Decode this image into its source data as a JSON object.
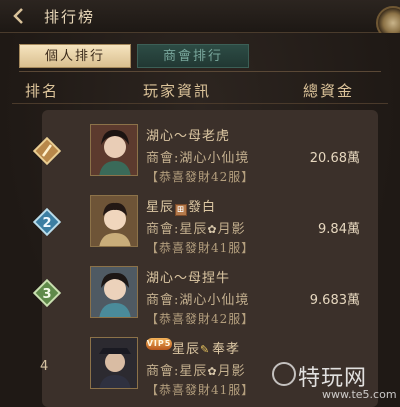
{
  "header": {
    "title": "排行榜"
  },
  "tabs": [
    {
      "label": "個人排行",
      "active": true
    },
    {
      "label": "商會排行",
      "active": false
    }
  ],
  "columns": {
    "rank": "排名",
    "player": "玩家資訊",
    "funds": "總資金"
  },
  "unit": "萬",
  "rows": [
    {
      "rank": "1",
      "rank_icon": "rank-1-diamond-icon",
      "name_prefix": "湖心～母老虎",
      "name_suffix": "",
      "guild": "商會:湖心小仙境",
      "server": "【恭喜發財42服】",
      "funds": "20.68"
    },
    {
      "rank": "2",
      "rank_icon": "rank-2-diamond-icon",
      "name_prefix": "星辰",
      "name_suffix": "發白",
      "guild_prefix": "商會:星辰",
      "guild_suffix": "月影",
      "server": "【恭喜發財41服】",
      "funds": "9.84"
    },
    {
      "rank": "3",
      "rank_icon": "rank-3-diamond-icon",
      "name_prefix": "湖心～母捏牛",
      "name_suffix": "",
      "guild": "商會:湖心小仙境",
      "server": "【恭喜發財42服】",
      "funds": "9.683"
    },
    {
      "rank": "4",
      "vip": "VIP5",
      "name_prefix": "星辰",
      "name_suffix": "奉孝",
      "guild_prefix": "商會:星辰",
      "guild_suffix": "月影",
      "server": "【恭喜發財41服】",
      "funds": ""
    }
  ],
  "watermark": {
    "main": "特玩网",
    "url": "www.te5.com"
  },
  "colors": {
    "tab_active": "#f6e4bf",
    "tab_inactive": "#2d4c45",
    "rank1": "#c69a5a",
    "rank2": "#4b8fb1",
    "rank3": "#7aa060"
  }
}
